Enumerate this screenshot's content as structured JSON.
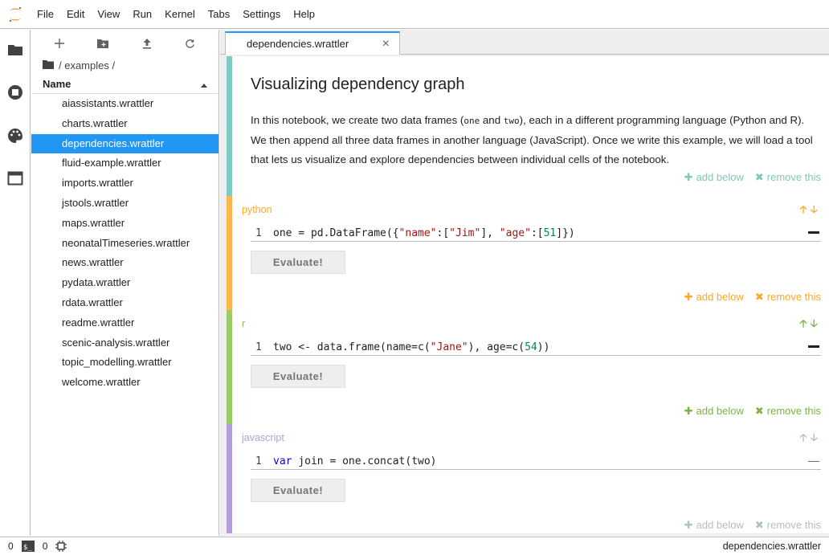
{
  "menubar": {
    "items": [
      "File",
      "Edit",
      "View",
      "Run",
      "Kernel",
      "Tabs",
      "Settings",
      "Help"
    ]
  },
  "filebrowser": {
    "breadcrumb": "/ examples /",
    "header": "Name",
    "files": [
      "aiassistants.wrattler",
      "charts.wrattler",
      "dependencies.wrattler",
      "fluid-example.wrattler",
      "imports.wrattler",
      "jstools.wrattler",
      "maps.wrattler",
      "neonatalTimeseries.wrattler",
      "news.wrattler",
      "pydata.wrattler",
      "rdata.wrattler",
      "readme.wrattler",
      "scenic-analysis.wrattler",
      "topic_modelling.wrattler",
      "welcome.wrattler"
    ],
    "selected_index": 2
  },
  "tab": {
    "title": "dependencies.wrattler",
    "close": "×"
  },
  "markdown": {
    "title": "Visualizing dependency graph",
    "text_1": "In this notebook, we create two data frames (",
    "code_1": "one",
    "text_2": " and ",
    "code_2": "two",
    "text_3": "), each in a different programming language (Python and R). We then append all three data frames in another language (JavaScript). Once we write this example, we will load a tool that lets us visualize and explore dependencies between individual cells of the notebook."
  },
  "actions": {
    "add_symbol": "✚",
    "add_label": "add below",
    "remove_symbol": "✖",
    "remove_label": "remove this"
  },
  "cells": {
    "python": {
      "language": "python",
      "line": "1",
      "code_a": "one = pd.DataFrame({",
      "code_s1": "\"name\"",
      "code_b": ":[",
      "code_s2": "\"Jim\"",
      "code_c": "], ",
      "code_s3": "\"age\"",
      "code_d": ":[",
      "code_n1": "51",
      "code_e": "]})",
      "button": "Evaluate!",
      "color": "#ffb74d"
    },
    "r": {
      "language": "r",
      "line": "1",
      "code_a": "two <- data.frame(name=c(",
      "code_s1": "\"Jane\"",
      "code_b": "), age=c(",
      "code_n1": "54",
      "code_c": "))",
      "button": "Evaluate!",
      "color": "#9ccc65"
    },
    "javascript": {
      "language": "javascript",
      "line": "1",
      "code_kw": "var",
      "code_a": " join = one.concat(two)",
      "button": "Evaluate!",
      "color": "#b39ddb"
    }
  },
  "colors": {
    "accent": "#2196f3",
    "markdown_bar": "#80cbc4",
    "js_action": "#b0bec5"
  },
  "statusbar": {
    "terminals": "0",
    "kernels": "0",
    "right": "dependencies.wrattler"
  }
}
